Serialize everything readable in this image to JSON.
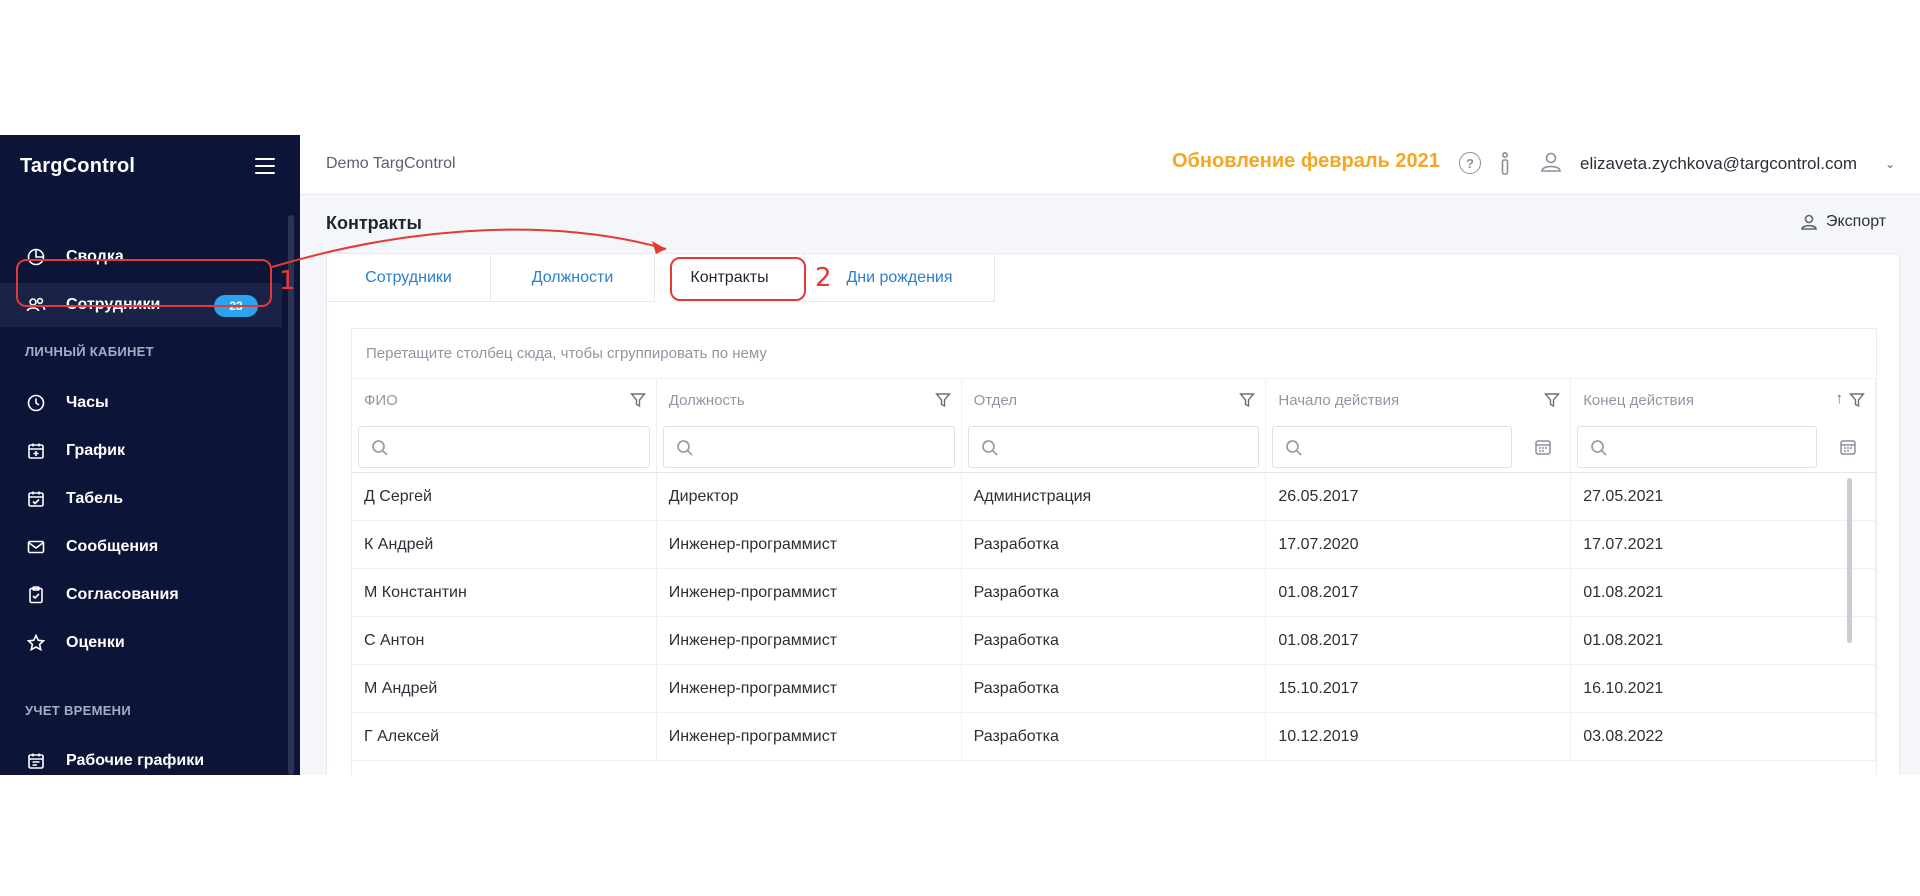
{
  "app": {
    "logo": "TargControl"
  },
  "sidebar": {
    "items": [
      {
        "label": "Сводка",
        "icon": "pie-chart-icon"
      },
      {
        "label": "Сотрудники",
        "icon": "users-icon",
        "badge": "23",
        "active": true
      }
    ],
    "sections": [
      {
        "title": "ЛИЧНЫЙ КАБИНЕТ",
        "items": [
          {
            "label": "Часы",
            "icon": "clock-icon"
          },
          {
            "label": "График",
            "icon": "calendar-plus-icon"
          },
          {
            "label": "Табель",
            "icon": "calendar-check-icon"
          },
          {
            "label": "Сообщения",
            "icon": "mail-icon"
          },
          {
            "label": "Согласования",
            "icon": "clipboard-icon"
          },
          {
            "label": "Оценки",
            "icon": "star-icon"
          }
        ]
      },
      {
        "title": "УЧЕТ ВРЕМЕНИ",
        "items": [
          {
            "label": "Рабочие графики",
            "icon": "calendar-icon"
          }
        ]
      }
    ]
  },
  "topbar": {
    "breadcrumb": "Demo TargControl",
    "update_text": "Обновление февраль 2021",
    "help_glyph": "?",
    "user_email": "elizaveta.zychkova@targcontrol.com",
    "accent_color": "#f5a623"
  },
  "page": {
    "title": "Контракты",
    "export_label": "Экспорт",
    "tabs": [
      {
        "label": "Сотрудники",
        "active": false
      },
      {
        "label": "Должности",
        "active": false
      },
      {
        "label": "Контракты",
        "active": true
      },
      {
        "label": "Дни рождения",
        "active": false
      }
    ]
  },
  "grid": {
    "group_panel_hint": "Перетащите столбец сюда, чтобы сгруппировать по нему",
    "columns": [
      "ФИО",
      "Должность",
      "Отдел",
      "Начало действия",
      "Конец действия"
    ],
    "sort_glyph": "↑",
    "rows": [
      [
        "Д Сергей",
        "Директор",
        "Администрация",
        "26.05.2017",
        "27.05.2021"
      ],
      [
        "К Андрей",
        "Инженер-программист",
        "Разработка",
        "17.07.2020",
        "17.07.2021"
      ],
      [
        "М Константин",
        "Инженер-программист",
        "Разработка",
        "01.08.2017",
        "01.08.2021"
      ],
      [
        "С Антон",
        "Инженер-программист",
        "Разработка",
        "01.08.2017",
        "01.08.2021"
      ],
      [
        "М Андрей",
        "Инженер-программист",
        "Разработка",
        "15.10.2017",
        "16.10.2021"
      ],
      [
        "Г Алексей",
        "Инженер-программист",
        "Разработка",
        "10.12.2019",
        "03.08.2022"
      ]
    ]
  },
  "annotations": {
    "step1": "1",
    "step2": "2",
    "color": "#e53935"
  }
}
